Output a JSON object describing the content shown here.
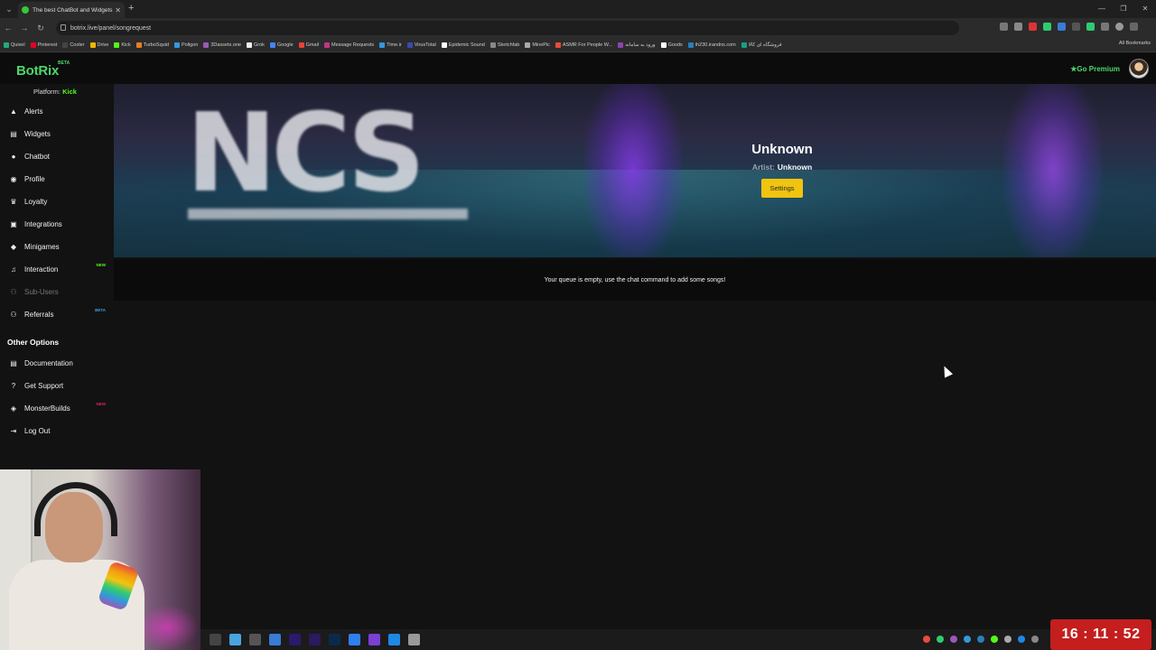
{
  "browser": {
    "tab_title": "The best ChatBot and Widgets",
    "url": "botrix.live/panel/songrequest",
    "bookmarks": [
      "Quixel",
      "Pinterest",
      "Cooler",
      "Drive",
      "Kick",
      "TurboSquid",
      "Poligon",
      "3Dassets.one",
      "Grok",
      "Google",
      "Gmail",
      "Message Requests",
      "Time.ir",
      "VirusTotal",
      "Epidemic Sound",
      "Sketchfab",
      "MinePic",
      "ASMR For People W...",
      "ورود به سامانه",
      "Goods",
      "ih230.irandns.com",
      "فروشگاه ای کالا"
    ],
    "all_bookmarks": "All Bookmarks"
  },
  "header": {
    "logo": "BotRix",
    "logo_badge": "BETA",
    "premium": "Go Premium"
  },
  "sidebar": {
    "platform_label": "Platform:",
    "platform_value": "Kick",
    "items": [
      {
        "label": "Alerts",
        "icon": "warning-icon"
      },
      {
        "label": "Widgets",
        "icon": "list-icon"
      },
      {
        "label": "Chatbot",
        "icon": "chat-icon"
      },
      {
        "label": "Profile",
        "icon": "user-icon"
      },
      {
        "label": "Loyalty",
        "icon": "trophy-icon"
      },
      {
        "label": "Integrations",
        "icon": "integrations-icon"
      },
      {
        "label": "Minigames",
        "icon": "gamepad-icon"
      },
      {
        "label": "Interaction",
        "icon": "music-icon",
        "badge": "NEW"
      },
      {
        "label": "Sub-Users",
        "icon": "users-icon"
      },
      {
        "label": "Referrals",
        "icon": "users-icon",
        "badge": "BETA"
      }
    ],
    "section": "Other Options",
    "other": [
      {
        "label": "Documentation",
        "icon": "document-icon"
      },
      {
        "label": "Get Support",
        "icon": "help-icon"
      },
      {
        "label": "MonsterBuilds",
        "icon": "controller-icon",
        "badge": "NEW"
      },
      {
        "label": "Log Out",
        "icon": "logout-icon"
      }
    ]
  },
  "player": {
    "banner_text": "NCS",
    "title": "Unknown",
    "artist_label": "Artist:",
    "artist": "Unknown",
    "settings": "Settings"
  },
  "queue": {
    "empty_message": "Your queue is empty, use the chat command to add some songs!"
  },
  "clock": "16 : 11 : 52",
  "colors": {
    "accent_green": "#4fd66a",
    "kick_green": "#53fc18",
    "settings_yellow": "#f1c40f",
    "clock_red": "#c41e1e"
  }
}
